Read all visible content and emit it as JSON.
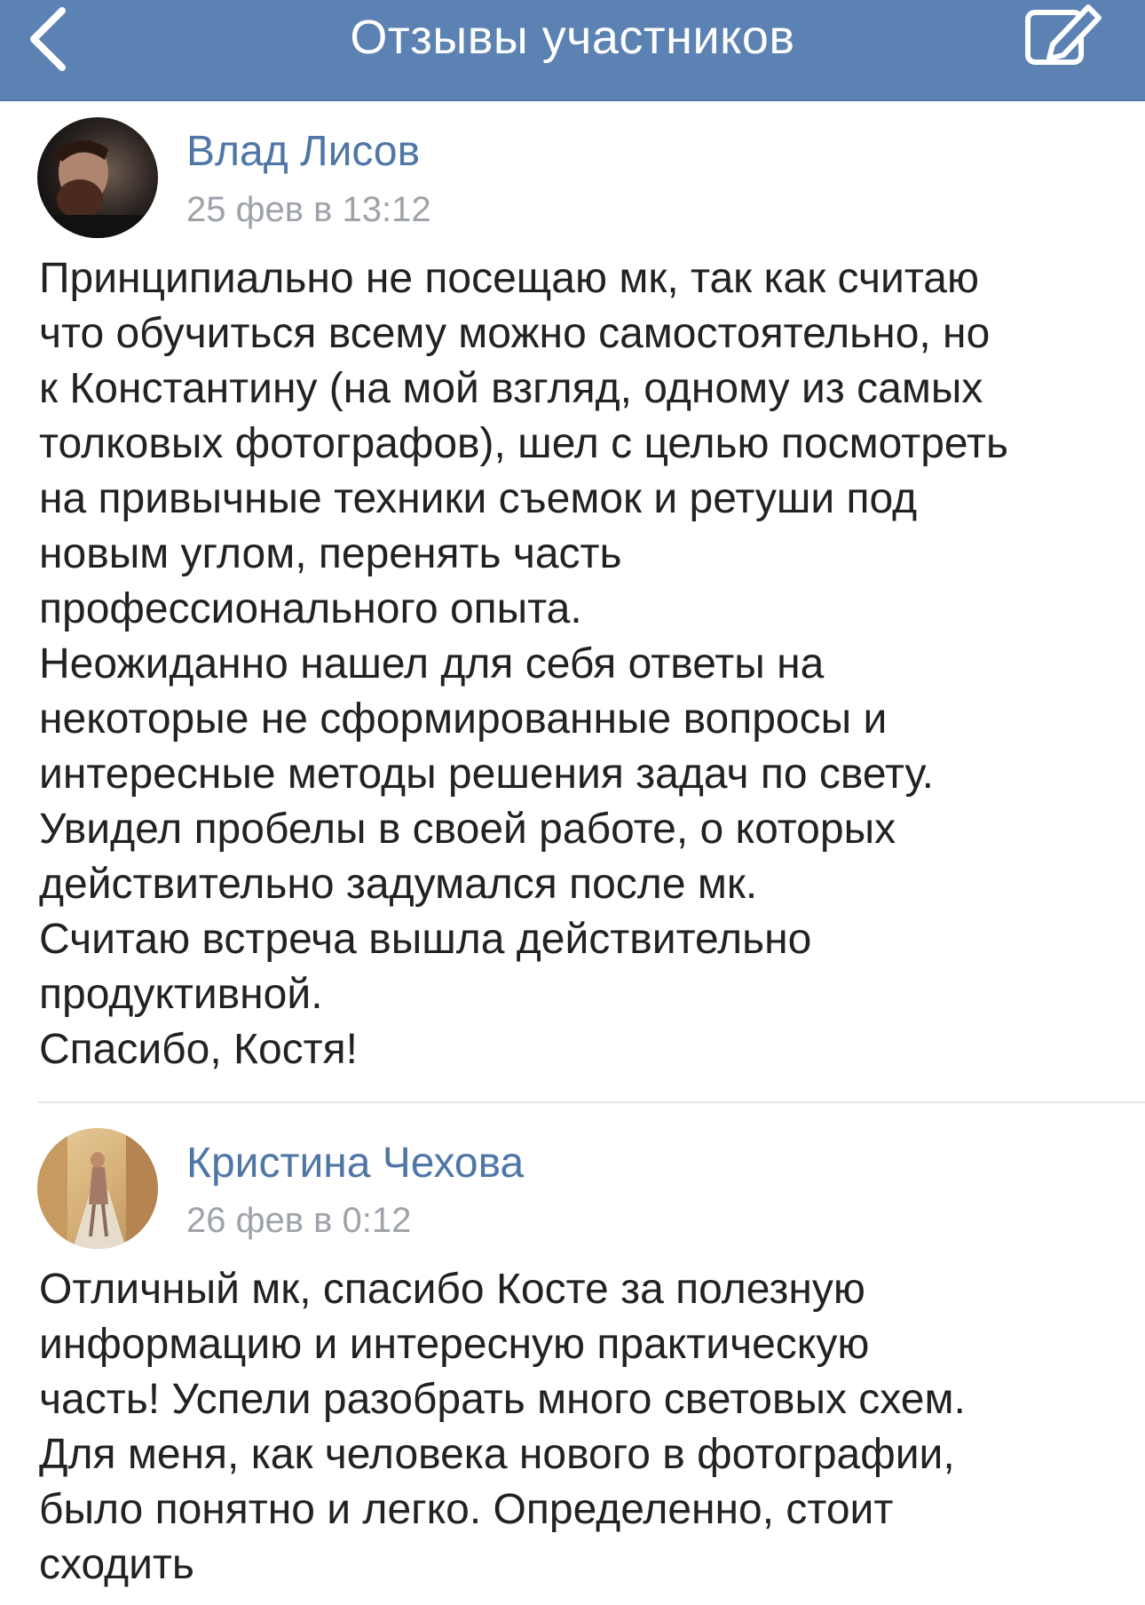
{
  "header": {
    "title": "Отзывы участников",
    "back_icon": "chevron-left-icon",
    "compose_icon": "edit-icon",
    "background_color": "#5b82b2"
  },
  "reviews": [
    {
      "author": "Влад Лисов",
      "date": "25 фев в 13:12",
      "lines": [
        "Принципиально не посещаю мк, так как считаю",
        "что обучиться всему можно самостоятельно, но",
        "к Константину (на мой взгляд, одному из самых",
        "толковых фотографов), шел с целью посмотреть",
        "на привычные техники съемок и ретуши под",
        "новым углом, перенять часть",
        "профессионального опыта.",
        "Неожиданно нашел для себя ответы на",
        "некоторые не сформированные вопросы и",
        "интересные методы решения задач по свету.",
        "Увидел пробелы в своей работе, о которых",
        "действительно задумался после мк.",
        "Считаю встреча вышла действительно",
        "продуктивной.",
        "Спасибо, Костя!"
      ]
    },
    {
      "author": "Кристина Чехова",
      "date": "26 фев в 0:12",
      "lines": [
        "Отличный мк, спасибо Косте за полезную",
        "информацию и интересную практическую",
        "часть! Успели разобрать много световых схем.",
        "Для меня, как человека нового в фотографии,",
        "было понятно и легко. Определенно, стоит",
        "сходить"
      ]
    }
  ],
  "colors": {
    "author_link": "#4f76a6",
    "date_gray": "#9ea3aa",
    "body_text": "#222222"
  }
}
